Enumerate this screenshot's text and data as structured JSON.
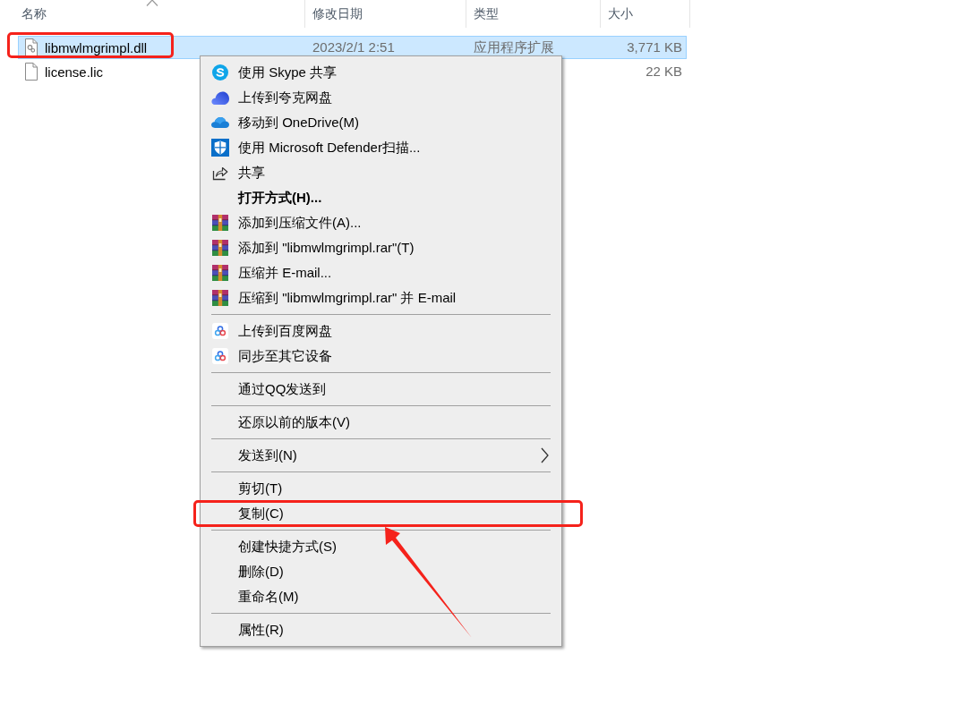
{
  "file_list": {
    "columns": [
      {
        "label": "名称",
        "sorted": true
      },
      {
        "label": "修改日期",
        "sorted": false
      },
      {
        "label": "类型",
        "sorted": false
      },
      {
        "label": "大小",
        "sorted": false
      }
    ],
    "files": [
      {
        "kind": "dll",
        "name": "libmwlmgrimpl.dll",
        "modified": "2023/2/1 2:51",
        "type": "应用程序扩展",
        "size": "3,771 KB",
        "selected": true,
        "marked": true
      },
      {
        "kind": "plain",
        "name": "license.lic",
        "size": "22 KB",
        "selected": false,
        "marked": false
      }
    ]
  },
  "context_menu": {
    "entries": [
      {
        "kind": "skype",
        "label": "使用 Skype 共享",
        "marked": false
      },
      {
        "kind": "quark",
        "label": "上传到夸克网盘",
        "marked": false
      },
      {
        "kind": "onedrive",
        "label": "移动到 OneDrive(M)",
        "marked": false
      },
      {
        "kind": "defender",
        "label": "使用 Microsoft Defender扫描...",
        "marked": false
      },
      {
        "kind": "share",
        "label": "共享",
        "marked": false
      },
      {
        "kind": "default",
        "label": "打开方式(H)...",
        "marked": false
      },
      {
        "kind": "winrar",
        "label": "添加到压缩文件(A)...",
        "marked": false
      },
      {
        "kind": "winrar",
        "label": "添加到 \"libmwlmgrimpl.rar\"(T)",
        "marked": false
      },
      {
        "kind": "winrar",
        "label": "压缩并 E-mail...",
        "marked": false
      },
      {
        "kind": "winrar",
        "label": "压缩到 \"libmwlmgrimpl.rar\" 并 E-mail",
        "marked": false
      },
      {
        "kind": "separator"
      },
      {
        "kind": "baidu",
        "label": "上传到百度网盘",
        "marked": false
      },
      {
        "kind": "baidu",
        "label": "同步至其它设备",
        "marked": false
      },
      {
        "kind": "separator"
      },
      {
        "kind": "text",
        "label": "通过QQ发送到",
        "marked": false
      },
      {
        "kind": "separator"
      },
      {
        "kind": "text",
        "label": "还原以前的版本(V)",
        "marked": false
      },
      {
        "kind": "separator"
      },
      {
        "kind": "submenu",
        "label": "发送到(N)",
        "marked": false
      },
      {
        "kind": "separator"
      },
      {
        "kind": "text",
        "label": "剪切(T)",
        "marked": false
      },
      {
        "kind": "text",
        "label": "复制(C)",
        "marked": true
      },
      {
        "kind": "separator"
      },
      {
        "kind": "text",
        "label": "创建快捷方式(S)",
        "marked": false
      },
      {
        "kind": "text",
        "label": "删除(D)",
        "marked": false
      },
      {
        "kind": "text",
        "label": "重命名(M)",
        "marked": false
      },
      {
        "kind": "separator"
      },
      {
        "kind": "text",
        "label": "属性(R)",
        "marked": false
      }
    ]
  },
  "annotation_arrow": true
}
